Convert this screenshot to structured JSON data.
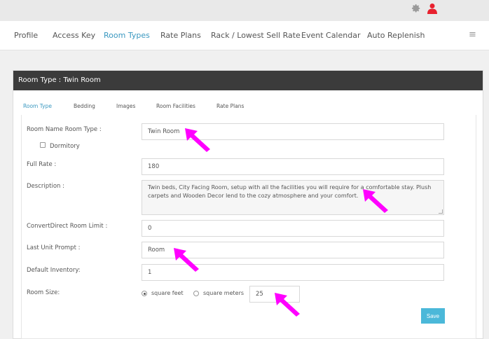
{
  "topbar": {
    "gear_icon": "gear-icon",
    "user_icon": "user-icon",
    "user_color": "#e8212e"
  },
  "nav": {
    "items": [
      "Profile",
      "Access Key",
      "Room Types",
      "Rate Plans",
      "Rack / Lowest Sell Rate",
      "Event Calendar",
      "Auto Replenish"
    ],
    "active": "Room Types",
    "menu_icon": "≡"
  },
  "panel": {
    "title": "Room Type : Twin Room"
  },
  "subtabs": {
    "items": [
      "Room Type",
      "Bedding",
      "Images",
      "Room Facilities",
      "Rate Plans"
    ],
    "active": "Room Type"
  },
  "form": {
    "room_name_label": "Room Name Room Type :",
    "room_name_value": "Twin Room",
    "dormitory_label": "Dormitory",
    "full_rate_label": "Full Rate :",
    "full_rate_value": "180",
    "description_label": "Description :",
    "description_value": "Twin beds, City Facing Room, setup with all the facilities you will require for a comfortable stay. Plush carpets and Wooden Decor lend to the cozy atmosphere and your comfort.",
    "cd_limit_label": "ConvertDirect Room Limit :",
    "cd_limit_value": "0",
    "last_unit_label": "Last Unit Prompt :",
    "last_unit_value": "Room",
    "default_inv_label": "Default Inventory:",
    "default_inv_value": "1",
    "room_size_label": "Room Size:",
    "size_option_feet": "square feet",
    "size_option_meters": "square meters",
    "room_size_value": "25",
    "save_label": "Save"
  },
  "colors": {
    "accent": "#3a98c0",
    "save_button": "#4bb8d9",
    "header_bar": "#3b3b3b",
    "annotation_arrow": "#ff00ff"
  }
}
